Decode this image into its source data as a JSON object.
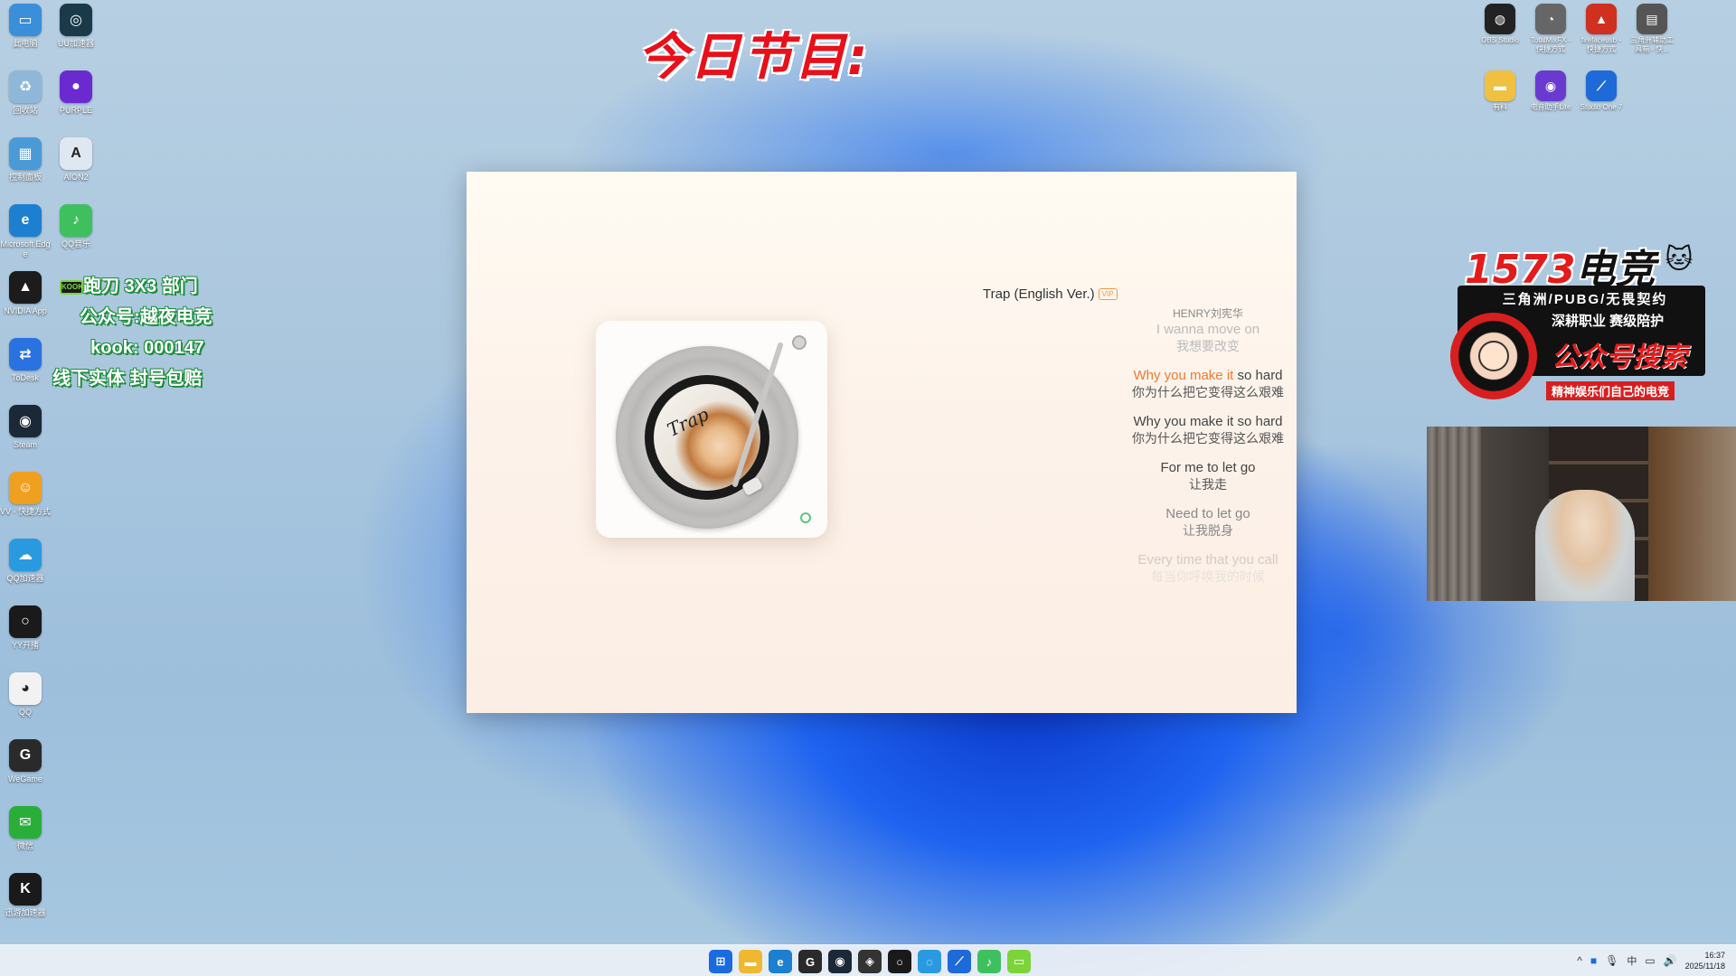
{
  "overlay": {
    "banner": "今日节目:",
    "promo_lines": [
      "跑刀 3X3 部门",
      "公众号:越夜电竞",
      "kook: 000147",
      "线下实体 封号包赔"
    ],
    "kook_badge": "KOOK"
  },
  "ad": {
    "logo_red": "1573",
    "logo_black": "电竞",
    "line1": "三角洲/PUBG/无畏契约",
    "line2": "深耕职业 赛级陪护",
    "line3": "公众号搜索",
    "line4": "精神娱乐们自己的电竞"
  },
  "desktop_icons_left": [
    {
      "label": "此电脑",
      "icon": "monitor-icon",
      "color": "#3a8fd8",
      "glyph": "▭"
    },
    {
      "label": "UU加速器",
      "icon": "uu-icon",
      "color": "#1a3a4a",
      "glyph": "◎"
    },
    {
      "label": "回收站",
      "icon": "recycle-bin-icon",
      "color": "#8fb8d8",
      "glyph": "♻"
    },
    {
      "label": "PURPLE",
      "icon": "purple-icon",
      "color": "#6a2ad0",
      "glyph": "●"
    },
    {
      "label": "控制面板",
      "icon": "control-panel-icon",
      "color": "#4a9ad8",
      "glyph": "▦"
    },
    {
      "label": "AION2",
      "icon": "aion-icon",
      "color": "#dfe8f0",
      "glyph": "A"
    },
    {
      "label": "Microsoft Edge",
      "icon": "edge-icon",
      "color": "#1c7fd0",
      "glyph": "e"
    },
    {
      "label": "QQ音乐",
      "icon": "qq-music-icon",
      "color": "#3fc05f",
      "glyph": "♪"
    },
    {
      "label": "NVIDIA App",
      "icon": "nvidia-icon",
      "color": "#1c1c1c",
      "glyph": "▲"
    },
    {
      "label": "ToDesk",
      "icon": "todesk-icon",
      "color": "#2a72e0",
      "glyph": "⇄"
    },
    {
      "label": "Steam",
      "icon": "steam-icon",
      "color": "#1b2838",
      "glyph": "◉"
    },
    {
      "label": "VV - 快捷方式",
      "icon": "vv-icon",
      "color": "#f0a020",
      "glyph": "☺"
    },
    {
      "label": "QQ加速器",
      "icon": "qq-accel-icon",
      "color": "#2a9ae0",
      "glyph": "☁"
    },
    {
      "label": "YY开播",
      "icon": "yy-icon",
      "color": "#1a1a1a",
      "glyph": "○"
    },
    {
      "label": "QQ",
      "icon": "qq-icon",
      "color": "#f2f2f2",
      "glyph": "◕"
    },
    {
      "label": "WeGame",
      "icon": "wegame-icon",
      "color": "#2a2a2a",
      "glyph": "G"
    },
    {
      "label": "微信",
      "icon": "wechat-icon",
      "color": "#2aae3a",
      "glyph": "✉"
    },
    {
      "label": "迅游加速器",
      "icon": "xunyou-icon",
      "color": "#1a1a1a",
      "glyph": "K"
    }
  ],
  "desktop_icons_right": [
    {
      "label": "OBS Studio",
      "icon": "obs-icon",
      "color": "#222",
      "glyph": "◍"
    },
    {
      "label": "TotalMixFX - 快捷方式",
      "icon": "totalmix-icon",
      "color": "#666",
      "glyph": "◔"
    },
    {
      "label": "firefaceusb - 快捷方式",
      "icon": "fireface-icon",
      "color": "#d03020",
      "glyph": "▲"
    },
    {
      "label": "三角洲辅助工具箱 - 快...",
      "icon": "toolbox-icon",
      "color": "#555",
      "glyph": "▤"
    },
    {
      "label": "有料",
      "icon": "folder-icon",
      "color": "#f0c040",
      "glyph": "▬"
    },
    {
      "label": "电音助手Lite",
      "icon": "audio-assistant-icon",
      "color": "#6a3ad0",
      "glyph": "◉"
    },
    {
      "label": "Studio One 7",
      "icon": "studio-one-icon",
      "color": "#1e6ad8",
      "glyph": "⟋"
    }
  ],
  "player": {
    "song_title": "Trap (English Ver.)",
    "vip_label": "VIP",
    "artist": "HENRY刘宪华",
    "album_script": "Trap",
    "lyrics": [
      {
        "en": "I wanna move on",
        "zh": "我想要改变",
        "style": "faded"
      },
      {
        "en_hl": "Why you make it",
        "en_rest": " so hard",
        "zh": "你为什么把它变得这么艰难",
        "style": "active"
      },
      {
        "en": "Why you make it so hard",
        "zh": "你为什么把它变得这么艰难",
        "style": "normal"
      },
      {
        "en": "For me to let go",
        "zh": "让我走",
        "style": "normal"
      },
      {
        "en": "Need to let go",
        "zh": "让我脱身",
        "style": "faded2"
      },
      {
        "en": "Every time that you call",
        "zh": "每当你呼唤我的时候",
        "style": "ghost"
      }
    ]
  },
  "taskbar": {
    "apps": [
      {
        "icon": "start-icon",
        "color": "#1a6ae0",
        "glyph": "⊞"
      },
      {
        "icon": "file-explorer-icon",
        "color": "#f0b830",
        "glyph": "▬"
      },
      {
        "icon": "edge-icon",
        "color": "#1c7fd0",
        "glyph": "e"
      },
      {
        "icon": "wegame-icon",
        "color": "#2a2a2a",
        "glyph": "G"
      },
      {
        "icon": "steam-icon",
        "color": "#1b2838",
        "glyph": "◉"
      },
      {
        "icon": "netease-icon",
        "color": "#333",
        "glyph": "◈"
      },
      {
        "icon": "yy-icon",
        "color": "#1a1a1a",
        "glyph": "○"
      },
      {
        "icon": "qq-accel-icon",
        "color": "#2a9ae0",
        "glyph": "◌"
      },
      {
        "icon": "studio-one-icon",
        "color": "#1e6ad8",
        "glyph": "⟋"
      },
      {
        "icon": "qq-music-icon",
        "color": "#3fc05f",
        "glyph": "♪"
      },
      {
        "icon": "kook-icon",
        "color": "#7cd43a",
        "glyph": "▭"
      }
    ],
    "tray": {
      "lang": "中",
      "time": "16:37",
      "date": "2025/11/18"
    }
  }
}
